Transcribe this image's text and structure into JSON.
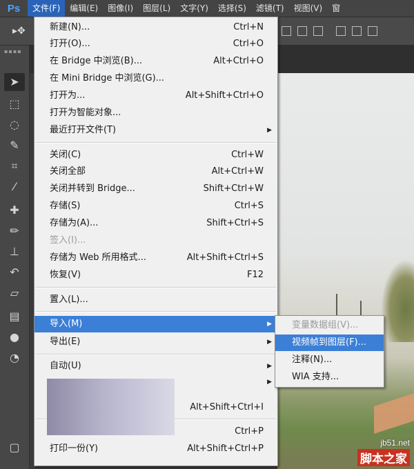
{
  "app": {
    "logo": "Ps"
  },
  "menubar": [
    "文件(F)",
    "编辑(E)",
    "图像(I)",
    "图层(L)",
    "文字(Y)",
    "选择(S)",
    "滤镜(T)",
    "视图(V)",
    "窗"
  ],
  "file_menu": {
    "items": [
      {
        "label": "新建(N)...",
        "shortcut": "Ctrl+N"
      },
      {
        "label": "打开(O)...",
        "shortcut": "Ctrl+O"
      },
      {
        "label": "在 Bridge 中浏览(B)...",
        "shortcut": "Alt+Ctrl+O"
      },
      {
        "label": "在 Mini Bridge 中浏览(G)...",
        "shortcut": ""
      },
      {
        "label": "打开为...",
        "shortcut": "Alt+Shift+Ctrl+O"
      },
      {
        "label": "打开为智能对象...",
        "shortcut": ""
      },
      {
        "label": "最近打开文件(T)",
        "shortcut": ""
      },
      {
        "label": "关闭(C)",
        "shortcut": "Ctrl+W"
      },
      {
        "label": "关闭全部",
        "shortcut": "Alt+Ctrl+W"
      },
      {
        "label": "关闭并转到 Bridge...",
        "shortcut": "Shift+Ctrl+W"
      },
      {
        "label": "存储(S)",
        "shortcut": "Ctrl+S"
      },
      {
        "label": "存储为(A)...",
        "shortcut": "Shift+Ctrl+S"
      },
      {
        "label": "签入(I)...",
        "shortcut": ""
      },
      {
        "label": "存储为 Web 所用格式...",
        "shortcut": "Alt+Shift+Ctrl+S"
      },
      {
        "label": "恢复(V)",
        "shortcut": "F12"
      },
      {
        "label": "置入(L)...",
        "shortcut": ""
      },
      {
        "label": "导入(M)",
        "shortcut": ""
      },
      {
        "label": "导出(E)",
        "shortcut": ""
      },
      {
        "label": "自动(U)",
        "shortcut": ""
      },
      {
        "label": "",
        "shortcut": "Alt+Shift+Ctrl+I"
      },
      {
        "label": "",
        "shortcut": "Ctrl+P"
      },
      {
        "label": "打印一份(Y)",
        "shortcut": "Alt+Shift+Ctrl+P"
      }
    ]
  },
  "import_submenu": [
    "变量数据组(V)...",
    "视频帧到图层(F)...",
    "注释(N)...",
    "WIA 支持..."
  ],
  "watermark": {
    "url": "jb51.net",
    "name": "脚本之家"
  }
}
